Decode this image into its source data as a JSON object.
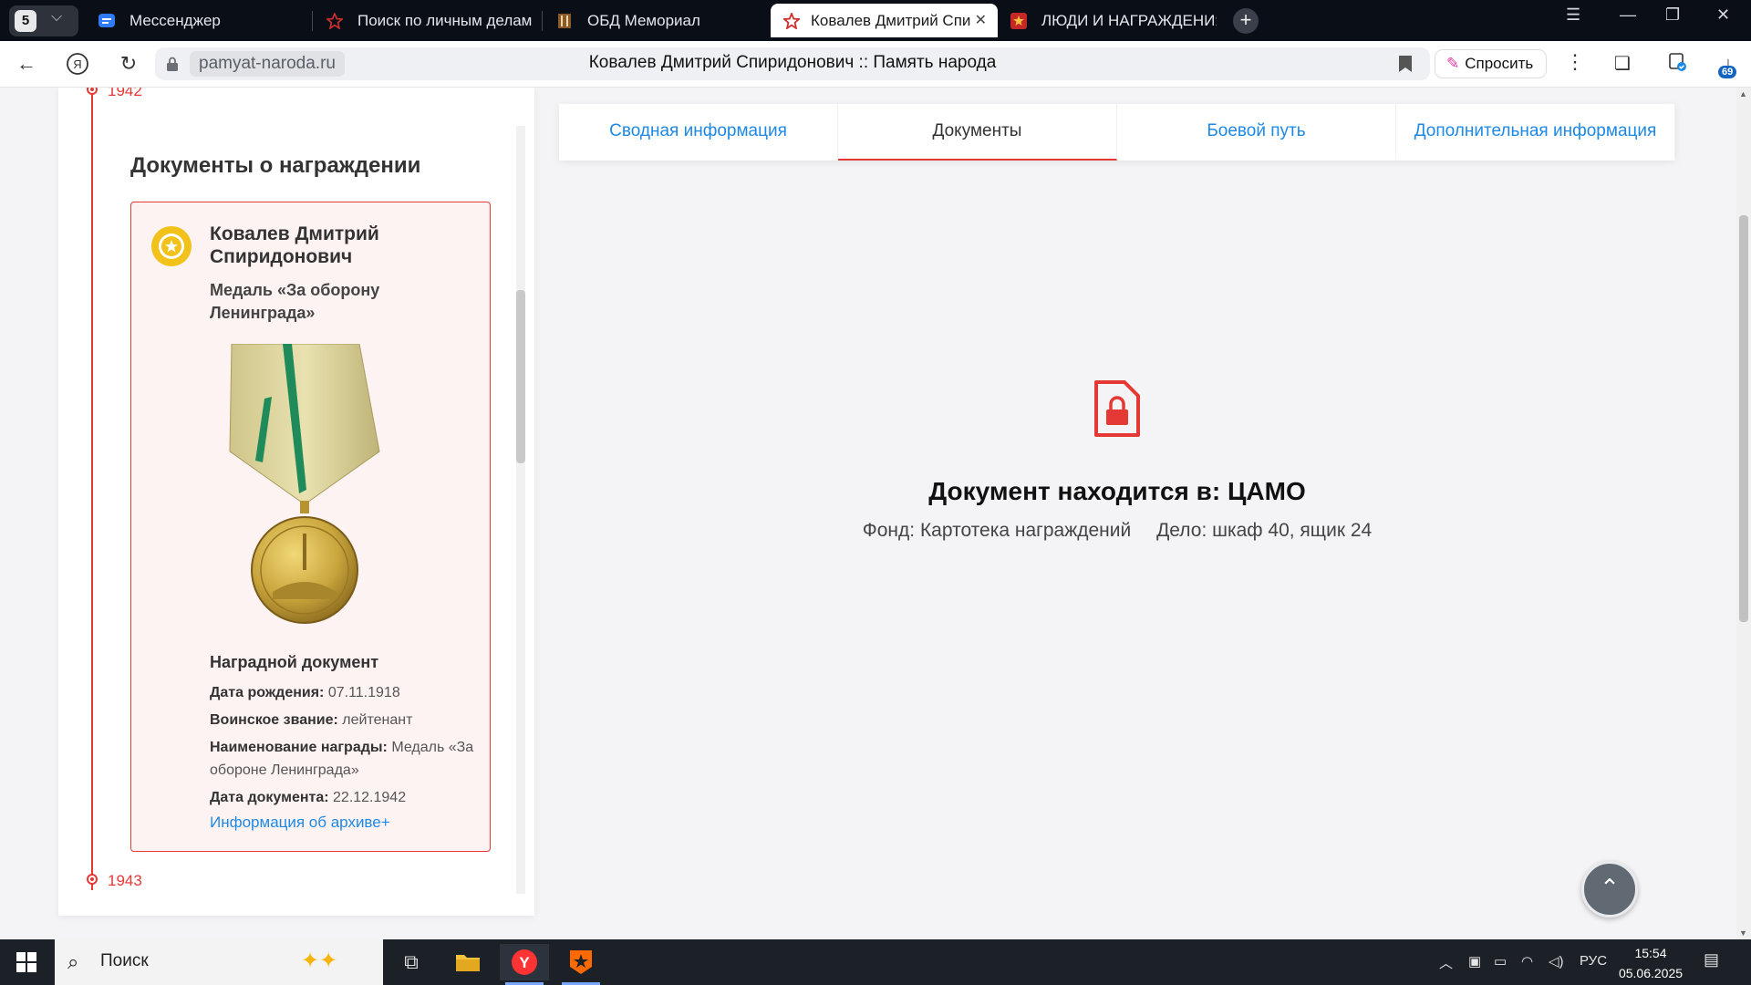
{
  "browser": {
    "tab_count": "5",
    "tabs": [
      {
        "label": "Мессенджер"
      },
      {
        "label": "Поиск по личным делам I"
      },
      {
        "label": "ОБД Мемориал"
      },
      {
        "label": "Ковалев Дмитрий Спи"
      },
      {
        "label": "ЛЮДИ И НАГРАЖДЕНИЯ"
      }
    ],
    "domain": "pamyat-naroda.ru",
    "page_title": "Ковалев Дмитрий Спиридонович :: Память народа",
    "ask_label": "Спросить",
    "downloads_badge": "69"
  },
  "sidebar": {
    "year_top": "1942",
    "section_title": "Документы о награждении",
    "award": {
      "person_name": "Ковалев Дмитрий Спиридонович",
      "award_name": "Медаль «За оборону Ленинграда»",
      "doc_type": "Наградной документ",
      "birth_label": "Дата рождения:",
      "birth_value": "07.11.1918",
      "rank_label": "Воинское звание:",
      "rank_value": "лейтенант",
      "award_label": "Наименование награды:",
      "award_value": "Медаль «За обороне Ленинграда»",
      "date_label": "Дата документа:",
      "date_value": "22.12.1942",
      "archive_link": "Информация об архиве+"
    },
    "year_bottom": "1943"
  },
  "page_tabs": [
    {
      "label": "Сводная информация"
    },
    {
      "label": "Документы"
    },
    {
      "label": "Боевой путь"
    },
    {
      "label": "Дополнительная информация"
    }
  ],
  "document": {
    "location": "Документ находится в: ЦАМО",
    "fond": "Фонд: Картотека награждений",
    "case": "Дело: шкаф 40, ящик 24"
  },
  "taskbar": {
    "search_placeholder": "Поиск",
    "language": "РУС",
    "time": "15:54",
    "date": "05.06.2025"
  },
  "colors": {
    "accent_red": "#e53935",
    "link_blue": "#1e88e5"
  }
}
